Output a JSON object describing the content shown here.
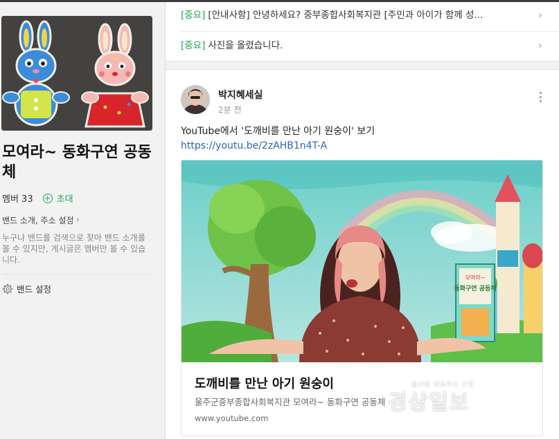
{
  "sidebar": {
    "band_name": "모여라~ 동화구연 공동체",
    "members_label": "멤버 33",
    "invite_label": "초대",
    "intro_link": "밴드 소개, 주소 설정",
    "description": "누구나 밴드를 검색으로 찾아 밴드 소개를 볼 수 있지만, 게시글은 멤버만 볼 수 있습니다.",
    "settings_label": "밴드 설정"
  },
  "notices": [
    {
      "tag": "[중요]",
      "text": "[안내사항] 안녕하세요? 중부종합사회복지관 [주민과 아이가 함께 성..."
    },
    {
      "tag": "[중요]",
      "text": "사진을 올렸습니다."
    }
  ],
  "post": {
    "author": "박지혜세실",
    "time": "2분 전",
    "text": "YouTube에서 '도깨비를 만난 아기 원숭이' 보기",
    "link": "https://youtu.be/2zAHB1n4T-A",
    "card": {
      "title": "도깨비를 만난 아기 원숭이",
      "description": "울주군중부종합사회복지관 모여라~ 동화구연 공동체",
      "domain": "www.youtube.com",
      "book_text_top": "모여라~",
      "book_text_main": "동화구연 공동체"
    }
  },
  "watermark": {
    "small": "울산을 대표하는 신문",
    "big": "경상일보"
  },
  "colors": {
    "accent_green": "#20a554",
    "link_blue": "#2a64b7",
    "background": "#f2f2f2"
  },
  "icons": [
    "plus-circle-icon",
    "chevron-right-icon",
    "gear-icon",
    "more-vertical-icon"
  ]
}
